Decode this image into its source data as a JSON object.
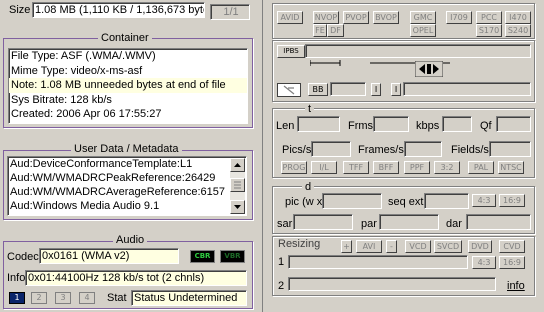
{
  "size": {
    "label": "Size",
    "value": "1.08 MB (1,110 KB / 1,136,673 byte",
    "page_counter": "1/1"
  },
  "container": {
    "title": "Container",
    "lines": [
      "File Type: ASF (.WMA/.WMV)",
      "Mime Type: video/x-ms-asf",
      "Note: 1.08 MB unneeded bytes at end of file",
      "Sys Bitrate: 128 kb/s",
      "Created:    2006 Apr 06   17:55:27"
    ]
  },
  "metadata": {
    "title": "User Data / Metadata",
    "lines": [
      "Aud:DeviceConformanceTemplate:L1",
      "Aud:WM/WMADRCPeakReference:26429",
      "Aud:WM/WMADRCAverageReference:6157",
      "Aud:Windows Media Audio 9.1"
    ]
  },
  "audio": {
    "title": "Audio",
    "codec_label": "Codec",
    "codec_value": "0x0161 (WMA v2)",
    "cbr": "CBR",
    "vbr": "VBR",
    "info_label": "Info",
    "info_value": "0x01:44100Hz  128 kb/s tot (2 chnls)",
    "tabs": [
      "1",
      "2",
      "3",
      "4"
    ],
    "stat_label": "Stat",
    "stat_value": "Status Undetermined"
  },
  "video_flags": {
    "buttons_row1": [
      "AVID",
      "NVOP",
      "PVOP",
      "BVOP",
      "GMC",
      "I709",
      "PCC",
      "I470"
    ],
    "buttons_row2": [
      "FE",
      "DF",
      "OPEL",
      "S170",
      "S240"
    ],
    "ipbs": "IPBS",
    "bb": "BB",
    "i1": "I",
    "i2": "I"
  },
  "timing": {
    "title": "t",
    "len": "Len",
    "frms": "Frms",
    "kbps": "kbps",
    "qf": "Qf",
    "pics": "Pics/s",
    "frames": "Frames/s",
    "fields": "Fields/s",
    "modes": [
      "PROG",
      "I/L",
      "TFF",
      "BFF",
      "PPF",
      "3:2",
      "PAL",
      "NTSC"
    ]
  },
  "dimensions": {
    "title": "d",
    "pic": "pic (w x",
    "seq": "seq ext",
    "r43": "4:3",
    "r169": "16:9",
    "sar": "sar",
    "par": "par",
    "dar": "dar"
  },
  "resizing": {
    "label": "Resizing",
    "plus": "+",
    "avi": "AVI",
    "minus": "-",
    "vcd": "VCD",
    "svcd": "SVCD",
    "dvd": "DVD",
    "cvd": "CVD",
    "row1": "1",
    "row2": "2",
    "r43": "4:3",
    "r169": "16:9",
    "info": "info"
  }
}
